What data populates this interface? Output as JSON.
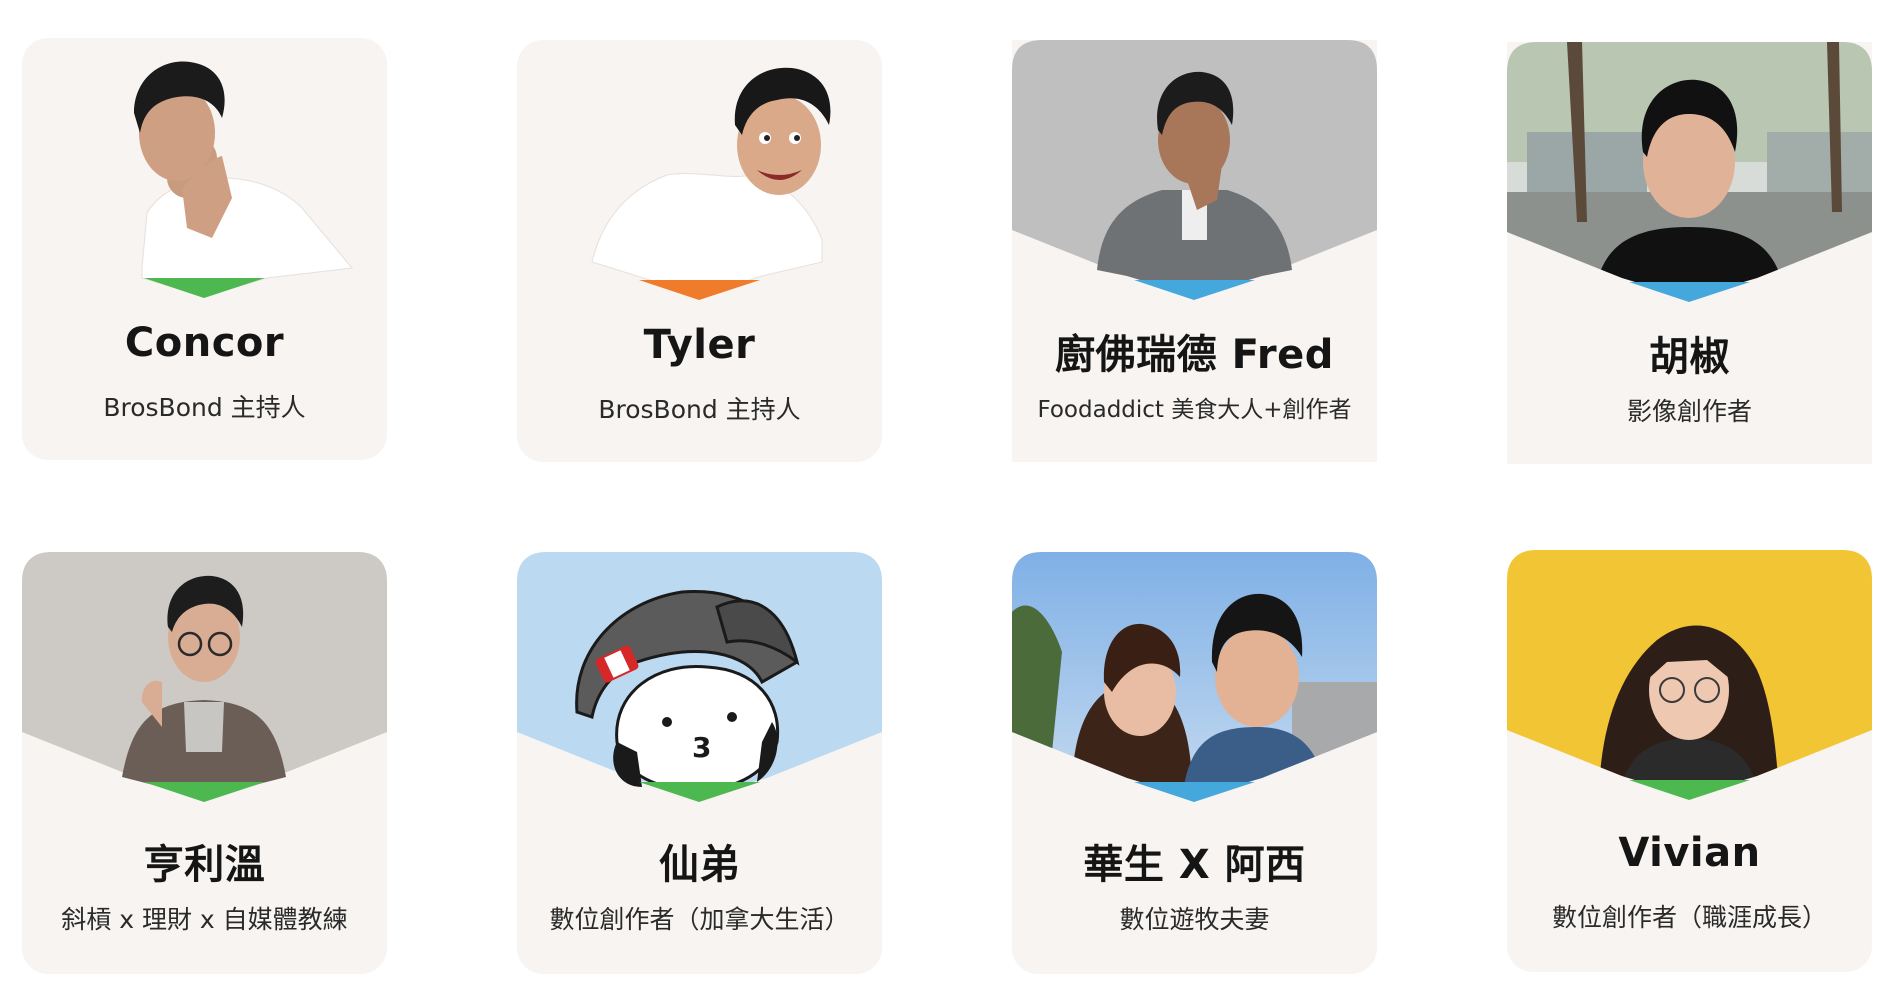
{
  "colors": {
    "card_bg": "#f7f4f1",
    "green": "#4cb84f",
    "orange": "#f07b2a",
    "blue": "#45a8dc"
  },
  "people": [
    {
      "name": "Concor",
      "role": "BrosBond 主持人",
      "accent": "green",
      "photo": "studio-cutout-man-chin-hand"
    },
    {
      "name": "Tyler",
      "role": "BrosBond 主持人",
      "accent": "orange",
      "photo": "studio-cutout-man-smiling"
    },
    {
      "name": "廚佛瑞德 Fred",
      "role": "Foodaddict 美食大人+創作者",
      "accent": "blue",
      "photo": "grey-studio-man-suit"
    },
    {
      "name": "胡椒",
      "role": "影像創作者",
      "accent": "blue",
      "photo": "outdoor-street-man"
    },
    {
      "name": "亨利溫",
      "role": "斜槓 x 理財 x 自媒體教練",
      "accent": "green",
      "photo": "grey-studio-man-glasses"
    },
    {
      "name": "仙弟",
      "role": "數位創作者（加拿大生活）",
      "accent": "green",
      "photo": "cartoon-avatar-cap"
    },
    {
      "name": "華生 X 阿西",
      "role": "數位遊牧夫妻",
      "accent": "blue",
      "photo": "couple-selfie-sky"
    },
    {
      "name": "Vivian",
      "role": "數位創作者（職涯成長）",
      "accent": "green",
      "photo": "yellow-wall-woman-glasses"
    }
  ]
}
